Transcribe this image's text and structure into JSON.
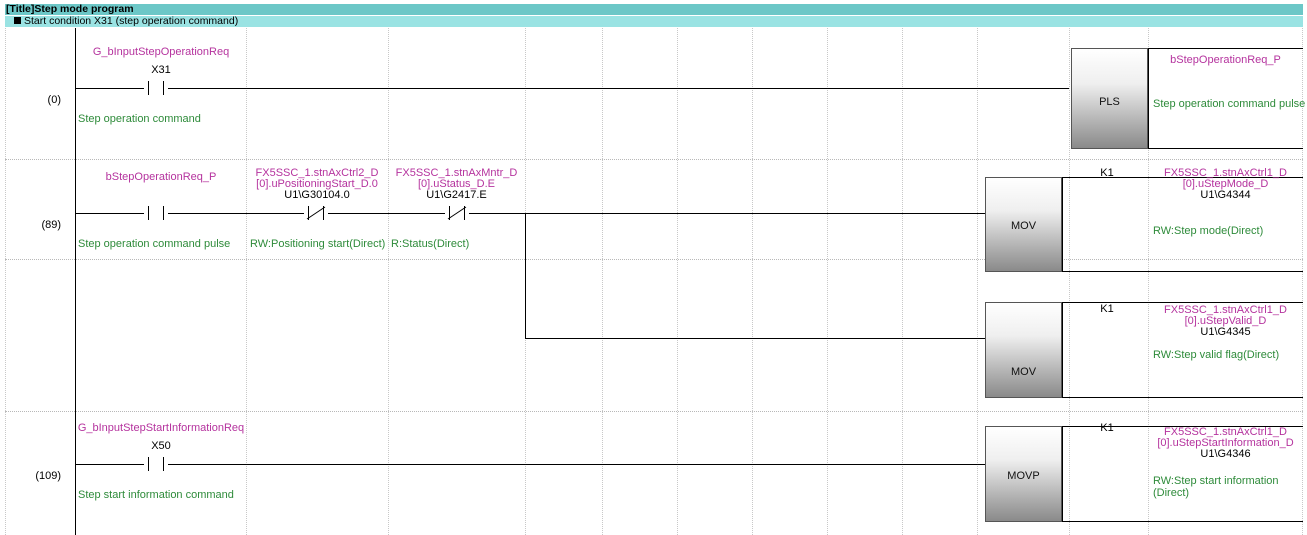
{
  "title": "[Title]Step mode program",
  "statement": "Start condition X31 (step operation command)",
  "rungs": [
    {
      "step": "(0)",
      "contacts": [
        {
          "type": "NO",
          "label": "G_bInputStepOperationReq",
          "address": "X31",
          "comment": "Step operation command"
        }
      ],
      "instruction": "PLS",
      "operands": [
        {
          "label": "bStepOperationReq_P",
          "address": "",
          "comment": "Step operation command pulse"
        }
      ]
    },
    {
      "step": "(89)",
      "contacts": [
        {
          "type": "NO",
          "label": "bStepOperationReq_P",
          "address": "",
          "comment": "Step operation command pulse"
        },
        {
          "type": "NC",
          "label": "FX5SSC_1.stnAxCtrl2_D [0].uPositioningStart_D.0",
          "label_line1": "FX5SSC_1.stnAxCtrl2_D",
          "label_line2": "[0].uPositioningStart_D.0",
          "address": "U1\\G30104.0",
          "comment": "RW:Positioning start(Direct)"
        },
        {
          "type": "NC",
          "label": "FX5SSC_1.stnAxMntr_D [0].uStatus_D.E",
          "label_line1": "FX5SSC_1.stnAxMntr_D",
          "label_line2": "[0].uStatus_D.E",
          "address": "U1\\G2417.E",
          "comment": "R:Status(Direct)"
        }
      ],
      "outputs": [
        {
          "instruction": "MOV",
          "source": "K1",
          "dest_line1": "FX5SSC_1.stnAxCtrl1_D",
          "dest_line2": "[0].uStepMode_D",
          "address": "U1\\G4344",
          "comment": "RW:Step mode(Direct)"
        },
        {
          "instruction": "MOV",
          "source": "K1",
          "dest_line1": "FX5SSC_1.stnAxCtrl1_D",
          "dest_line2": "[0].uStepValid_D",
          "address": "U1\\G4345",
          "comment": "RW:Step valid flag(Direct)"
        }
      ]
    },
    {
      "step": "(109)",
      "contacts": [
        {
          "type": "NO",
          "label": "G_bInputStepStartInformationReq",
          "address": "X50",
          "comment": "Step start information command"
        }
      ],
      "outputs": [
        {
          "instruction": "MOVP",
          "source": "K1",
          "dest_line1": "FX5SSC_1.stnAxCtrl1_D",
          "dest_line2": "[0].uStepStartInformation_D",
          "address": "U1\\G4346",
          "comment": "RW:Step start information (Direct)"
        }
      ]
    }
  ],
  "icons": {
    "no_contact": "normally-open-contact-icon",
    "nc_contact": "normally-closed-contact-icon",
    "statement_marker": "black-square-icon"
  },
  "colors": {
    "title_bar": "#6cc7c7",
    "statement_bar": "#9ae3e3",
    "device_label": "#b5339e",
    "comment": "#2e8b3a"
  }
}
